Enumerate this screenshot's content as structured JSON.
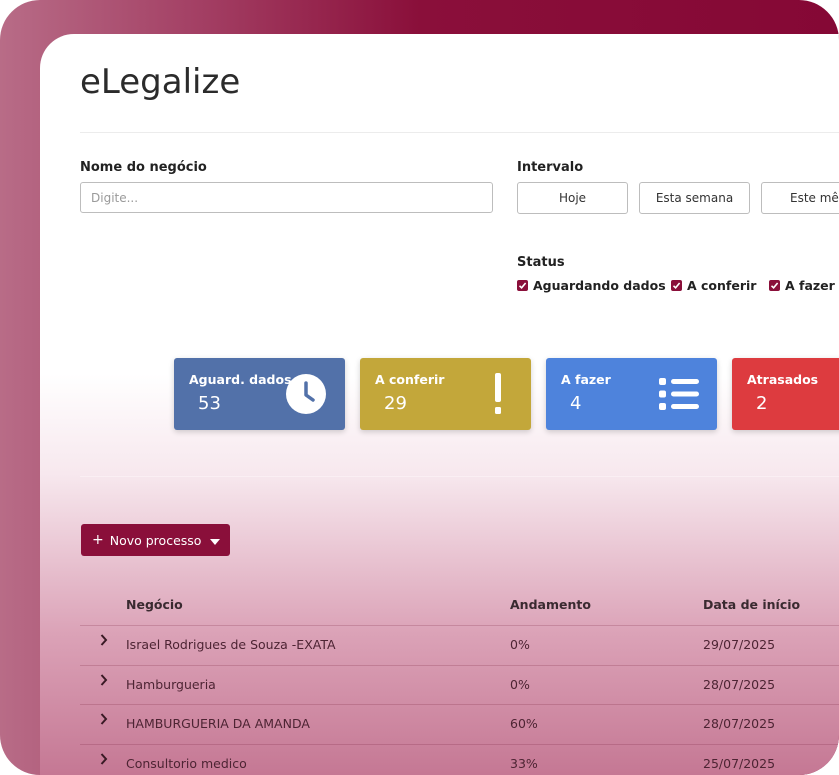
{
  "app": {
    "title": "eLegalize"
  },
  "filters": {
    "business_label": "Nome do negócio",
    "business_placeholder": "Digite...",
    "interval_label": "Intervalo",
    "interval_buttons": [
      "Hoje",
      "Esta semana",
      "Este mê"
    ],
    "status_label": "Status",
    "status_options": [
      {
        "label": "Aguardando dados",
        "checked": true
      },
      {
        "label": "A conferir",
        "checked": true
      },
      {
        "label": "A fazer",
        "checked": true
      }
    ],
    "checkbox_color": "#8a0f3a"
  },
  "cards": [
    {
      "label": "Aguard. dados",
      "value": "53",
      "color": "#5271a9",
      "icon": "clock-icon"
    },
    {
      "label": "A conferir",
      "value": "29",
      "color": "#c3a73a",
      "icon": "exclamation-icon"
    },
    {
      "label": "A fazer",
      "value": "4",
      "color": "#4e83dc",
      "icon": "list-icon"
    },
    {
      "label": "Atrasados",
      "value": "2",
      "color": "#dd3b3f",
      "icon": ""
    }
  ],
  "actions": {
    "new_process_label": "Novo processo"
  },
  "table": {
    "columns": [
      "Negócio",
      "Andamento",
      "Data de início"
    ],
    "rows": [
      {
        "business": "Israel Rodrigues de Souza -EXATA",
        "progress": "0%",
        "start": "29/07/2025"
      },
      {
        "business": "Hamburgueria",
        "progress": "0%",
        "start": "28/07/2025"
      },
      {
        "business": "HAMBURGUERIA DA AMANDA",
        "progress": "60%",
        "start": "28/07/2025"
      },
      {
        "business": "Consultorio medico",
        "progress": "33%",
        "start": "25/07/2025"
      }
    ]
  },
  "theme": {
    "brand": "#8a0f3a"
  }
}
